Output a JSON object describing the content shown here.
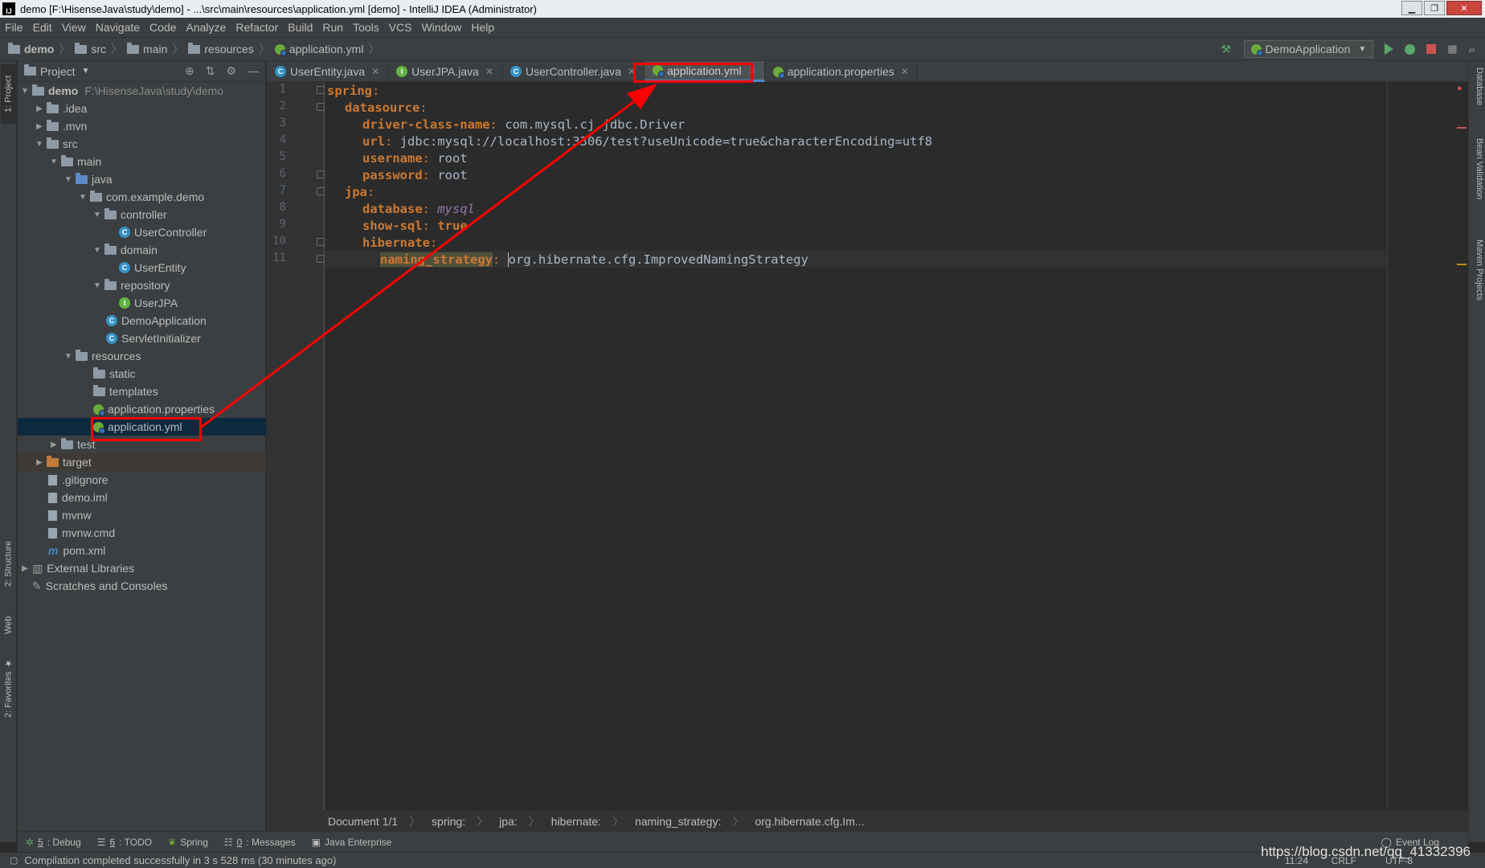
{
  "window": {
    "title": "demo [F:\\HisenseJava\\study\\demo] - ...\\src\\main\\resources\\application.yml [demo] - IntelliJ IDEA (Administrator)",
    "logo": "IJ"
  },
  "menu": [
    "File",
    "Edit",
    "View",
    "Navigate",
    "Code",
    "Analyze",
    "Refactor",
    "Build",
    "Run",
    "Tools",
    "VCS",
    "Window",
    "Help"
  ],
  "navbar": {
    "crumbs": [
      "demo",
      "src",
      "main",
      "resources",
      "application.yml"
    ],
    "run_config": "DemoApplication"
  },
  "left_stripe": {
    "project": "1: Project",
    "structure": "2: Structure",
    "web": "Web",
    "favorites": "2: Favorites"
  },
  "right_stripe": {
    "database": "Database",
    "bean_validation": "Bean Validation",
    "maven": "Maven Projects"
  },
  "project_panel": {
    "title": "Project",
    "tree": [
      {
        "label": "demo",
        "hint": "F:\\HisenseJava\\study\\demo",
        "icon": "folder-icon"
      },
      {
        "label": ".idea",
        "icon": "folder-icon"
      },
      {
        "label": ".mvn",
        "icon": "folder-icon"
      },
      {
        "label": "src",
        "icon": "folder-icon"
      },
      {
        "label": "main",
        "icon": "folder-icon"
      },
      {
        "label": "java",
        "icon": "source-folder-icon"
      },
      {
        "label": "com.example.demo",
        "icon": "package-icon"
      },
      {
        "label": "controller",
        "icon": "package-icon"
      },
      {
        "label": "UserController",
        "icon": "class-icon"
      },
      {
        "label": "domain",
        "icon": "package-icon"
      },
      {
        "label": "UserEntity",
        "icon": "class-icon"
      },
      {
        "label": "repository",
        "icon": "package-icon"
      },
      {
        "label": "UserJPA",
        "icon": "interface-icon"
      },
      {
        "label": "DemoApplication",
        "icon": "spring-boot-class-icon"
      },
      {
        "label": "ServletInitializer",
        "icon": "class-icon"
      },
      {
        "label": "resources",
        "icon": "resources-folder-icon"
      },
      {
        "label": "static",
        "icon": "folder-icon"
      },
      {
        "label": "templates",
        "icon": "folder-icon"
      },
      {
        "label": "application.properties",
        "icon": "spring-config-icon"
      },
      {
        "label": "application.yml",
        "icon": "spring-config-icon"
      },
      {
        "label": "test",
        "icon": "folder-icon"
      },
      {
        "label": "target",
        "icon": "excluded-folder-icon"
      },
      {
        "label": ".gitignore",
        "icon": "file-icon"
      },
      {
        "label": "demo.iml",
        "icon": "file-icon"
      },
      {
        "label": "mvnw",
        "icon": "file-icon"
      },
      {
        "label": "mvnw.cmd",
        "icon": "file-icon"
      },
      {
        "label": "pom.xml",
        "icon": "maven-icon"
      },
      {
        "label": "External Libraries",
        "icon": "library-icon"
      },
      {
        "label": "Scratches and Consoles",
        "icon": "scratch-icon"
      }
    ]
  },
  "tabs": [
    {
      "label": "UserEntity.java",
      "icon": "class-icon"
    },
    {
      "label": "UserJPA.java",
      "icon": "interface-icon"
    },
    {
      "label": "UserController.java",
      "icon": "class-icon"
    },
    {
      "label": "application.yml",
      "icon": "spring-config-icon",
      "active": true
    },
    {
      "label": "application.properties",
      "icon": "spring-config-icon"
    }
  ],
  "editor": {
    "line_numbers": [
      "1",
      "2",
      "3",
      "4",
      "5",
      "6",
      "7",
      "8",
      "9",
      "10",
      "11"
    ],
    "lines": [
      {
        "key": "spring",
        "sep": ":",
        "value": ""
      },
      {
        "key": "datasource",
        "sep": ":",
        "value": ""
      },
      {
        "key": "driver-class-name",
        "sep": ":",
        "value": "com.mysql.cj.jdbc.Driver"
      },
      {
        "key": "url",
        "sep": ":",
        "value": "jdbc:mysql://localhost:3306/test?useUnicode=true&characterEncoding=utf8"
      },
      {
        "key": "username",
        "sep": ":",
        "value": "root"
      },
      {
        "key": "password",
        "sep": ":",
        "value": "root"
      },
      {
        "key": "jpa",
        "sep": ":",
        "value": ""
      },
      {
        "key": "database",
        "sep": ":",
        "value": "mysql"
      },
      {
        "key": "show-sql",
        "sep": ":",
        "value": "true"
      },
      {
        "key": "hibernate",
        "sep": ":",
        "value": ""
      },
      {
        "key": "naming_strategy",
        "sep": ":",
        "value": "org.hibernate.cfg.ImprovedNamingStrategy"
      }
    ],
    "crumbs": [
      "Document 1/1",
      "spring:",
      "jpa:",
      "hibernate:",
      "naming_strategy:",
      "org.hibernate.cfg.Im..."
    ]
  },
  "toolwindows": [
    {
      "key": "5",
      "label": ": Debug",
      "icon": "debug-icon"
    },
    {
      "key": "6",
      "label": ": TODO",
      "icon": "todo-icon"
    },
    {
      "key": "",
      "label": "Spring",
      "icon": "spring-icon"
    },
    {
      "key": "0",
      "label": ": Messages",
      "icon": "messages-icon"
    },
    {
      "key": "",
      "label": "Java Enterprise",
      "icon": "java-enterprise-icon"
    }
  ],
  "event_log": "Event Log",
  "status": {
    "message": "Compilation completed successfully in 3 s 528 ms (30 minutes ago)",
    "position": "11:24",
    "line_sep": "CRLF",
    "encoding": "UTF-8"
  },
  "watermark": "https://blog.csdn.net/qq_41332396",
  "colors": {
    "annotation": "#ff0000",
    "keyword": "#cc7832",
    "selection": "#0d293e"
  }
}
